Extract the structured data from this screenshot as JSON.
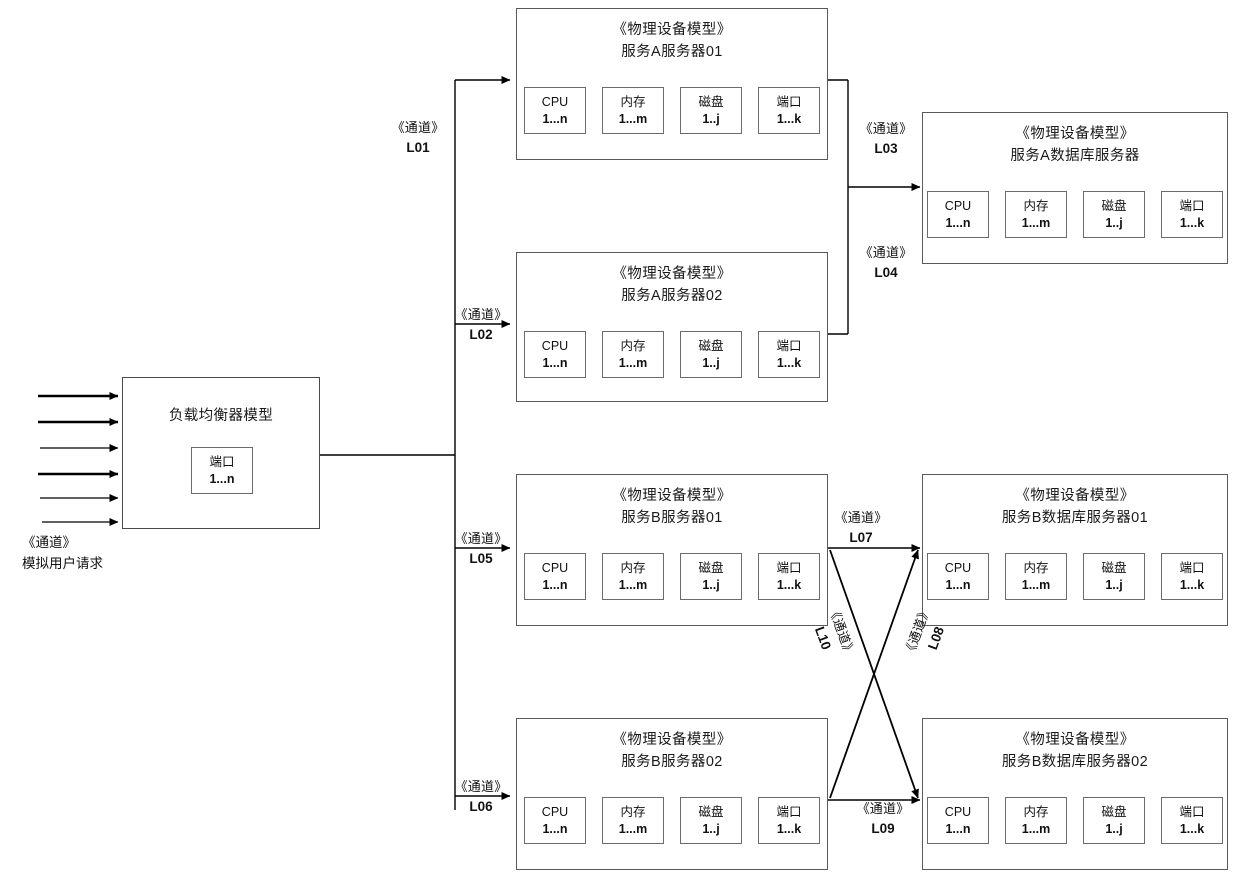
{
  "diagram": {
    "stereotype_device": "《物理设备模型》",
    "stereotype_channel": "《通道》",
    "load_balancer": {
      "title": "负载均衡器模型",
      "port": {
        "name": "端口",
        "range": "1...n"
      }
    },
    "user_request": {
      "stereotype": "《通道》",
      "label": "模拟用户请求",
      "arrow_count": 6
    },
    "parts": [
      {
        "name": "CPU",
        "range": "1...n"
      },
      {
        "name": "内存",
        "range": "1...m"
      },
      {
        "name": "磁盘",
        "range": "1..j"
      },
      {
        "name": "端口",
        "range": "1...k"
      }
    ],
    "devices": [
      {
        "id": "svc-a-server-01",
        "stereotype": "《物理设备模型》",
        "name": "服务A服务器01"
      },
      {
        "id": "svc-a-server-02",
        "stereotype": "《物理设备模型》",
        "name": "服务A服务器02"
      },
      {
        "id": "svc-a-db-server",
        "stereotype": "《物理设备模型》",
        "name": "服务A数据库服务器"
      },
      {
        "id": "svc-b-server-01",
        "stereotype": "《物理设备模型》",
        "name": "服务B服务器01"
      },
      {
        "id": "svc-b-server-02",
        "stereotype": "《物理设备模型》",
        "name": "服务B服务器02"
      },
      {
        "id": "svc-b-db-server-01",
        "stereotype": "《物理设备模型》",
        "name": "服务B数据库服务器01"
      },
      {
        "id": "svc-b-db-server-02",
        "stereotype": "《物理设备模型》",
        "name": "服务B数据库服务器02"
      }
    ],
    "channels": [
      {
        "id": "L01",
        "stereotype": "《通道》",
        "code": "L01"
      },
      {
        "id": "L02",
        "stereotype": "《通道》",
        "code": "L02"
      },
      {
        "id": "L03",
        "stereotype": "《通道》",
        "code": "L03"
      },
      {
        "id": "L04",
        "stereotype": "《通道》",
        "code": "L04"
      },
      {
        "id": "L05",
        "stereotype": "《通道》",
        "code": "L05"
      },
      {
        "id": "L06",
        "stereotype": "《通道》",
        "code": "L06"
      },
      {
        "id": "L07",
        "stereotype": "《通道》",
        "code": "L07"
      },
      {
        "id": "L08",
        "stereotype": "《通道》",
        "code": "L08"
      },
      {
        "id": "L09",
        "stereotype": "《通道》",
        "code": "L09"
      },
      {
        "id": "L10",
        "stereotype": "《通道》",
        "code": "L10"
      }
    ],
    "colors": {
      "line": "#000000",
      "box_border": "#5a5a5a",
      "part_border": "#6b6b6b",
      "text": "#111111",
      "background": "#ffffff"
    }
  }
}
